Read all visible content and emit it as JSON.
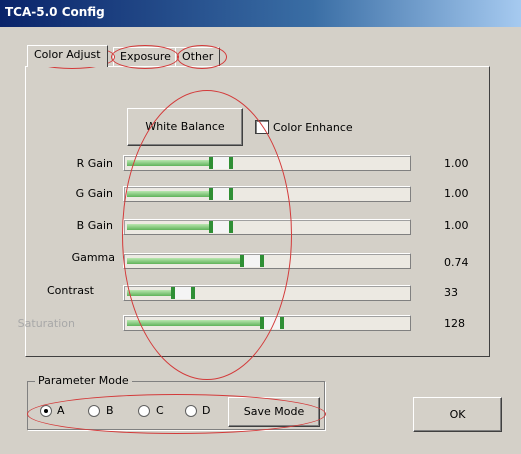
{
  "window": {
    "title": "TCA-5.0 Config"
  },
  "tabs": [
    {
      "label": "Color Adjust",
      "active": true
    },
    {
      "label": "Exposure",
      "active": false
    },
    {
      "label": "Other",
      "active": false
    }
  ],
  "white_balance_button": "White Balance",
  "color_enhance": {
    "label": "Color Enhance",
    "checked": false
  },
  "sliders": [
    {
      "label": "R Gain",
      "value": "1.00",
      "position": 0.32,
      "enabled": true
    },
    {
      "label": "G Gain",
      "value": "1.00",
      "position": 0.32,
      "enabled": true
    },
    {
      "label": "B Gain",
      "value": "1.00",
      "position": 0.32,
      "enabled": true
    },
    {
      "label": "Gamma",
      "value": "0.74",
      "position": 0.44,
      "enabled": true
    },
    {
      "label": "Contrast",
      "value": "33",
      "position": 0.17,
      "enabled": true
    },
    {
      "label": "Saturation",
      "value": "128",
      "position": 0.52,
      "enabled": false
    }
  ],
  "parameter_mode": {
    "label": "Parameter Mode",
    "options": [
      "A",
      "B",
      "C",
      "D"
    ],
    "selected": "A",
    "save_button": "Save Mode"
  },
  "ok_button": "OK",
  "colors": {
    "title_bar": "#0a246a",
    "slider_fill": "#5fb35a",
    "annotation": "#d33a3a",
    "face": "#d4d0c8"
  }
}
